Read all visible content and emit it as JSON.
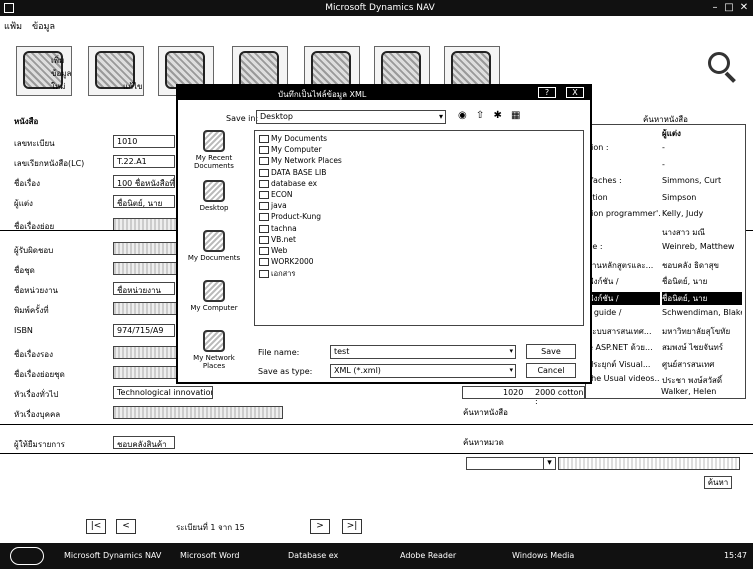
{
  "window": {
    "title": "Microsoft Dynamics NAV"
  },
  "menu": {
    "items": [
      "แฟ้ม",
      "ข้อมูล"
    ]
  },
  "toolbar": {
    "buttons": [
      {
        "label": "เพิ่ม\nข้อมูล\nใหม่"
      },
      {
        "label": "แก้ไข"
      },
      {
        "label": "ลบ"
      },
      {
        "label": ""
      },
      {
        "label": ""
      },
      {
        "label": ""
      },
      {
        "label": ""
      }
    ]
  },
  "form": {
    "section_title": "หนังสือ",
    "fields": [
      {
        "label": "เลขทะเบียน",
        "value": "1010",
        "gray": false
      },
      {
        "label": "เลขเรียกหนังสือ(LC)",
        "value": "T.22.A1",
        "gray": false
      },
      {
        "label": "ชื่อเรื่อง",
        "value": "100 ชื่อหนังสือที่",
        "gray": false
      },
      {
        "label": "ผู้แต่ง",
        "value": "ชื่อนิตย์, นาย",
        "gray": false
      },
      {
        "label": "ชื่อเรื่องย่อย",
        "value": "",
        "gray": true
      },
      {
        "label": "ผู้รับผิดชอบ",
        "value": "",
        "gray": true
      },
      {
        "label": "ชื่อชุด",
        "value": "",
        "gray": true
      },
      {
        "label": "ชื่อหน่วยงาน",
        "value": "ชื่อหน่วยงาน",
        "gray": false
      },
      {
        "label": "พิมพ์ครั้งที่",
        "value": "",
        "gray": true
      },
      {
        "label": "ISBN",
        "value": "974/715/A9",
        "gray": false
      },
      {
        "label": "ชื่อเรื่องรอง",
        "value": "",
        "gray": true
      },
      {
        "label": "ชื่อเรื่องย่อยชุด",
        "value": "",
        "gray": true
      },
      {
        "label": "หัวเรื่องทั่วไป",
        "value": "Technological innovations",
        "gray": false
      },
      {
        "label": "หัวเรื่องบุคคล",
        "value": "",
        "gray": true
      },
      {
        "label": "ผู้ให้ยืมรายการ",
        "value": "ชอบคลังสินค้า",
        "gray": false
      }
    ]
  },
  "table": {
    "search_label": "ค้นหาหนังสือ",
    "headers": [
      "",
      "ผู้แต่ง"
    ],
    "rows": [
      {
        "c1": "tion :",
        "c2": "-"
      },
      {
        "c1": "",
        "c2": "-"
      },
      {
        "c1": "ifaches :",
        "c2": "Simmons, Curt"
      },
      {
        "c1": "ction",
        "c2": "Simpson"
      },
      {
        "c1": "tion programmer'...",
        "c2": "Kelly, Judy"
      },
      {
        "c1": "",
        "c2": "นางสาว มณี"
      },
      {
        "c1": "ce :",
        "c2": "Weinreb, Matthew"
      },
      {
        "c1": "งานหลักสูตรและ...",
        "c2": "ชอบคลัง ธิดาสุข"
      },
      {
        "c1": "ฟังก์ชัน /",
        "c2": "ชื่อนิตย์, นาย"
      },
      {
        "c1": "ฟังก์ชัน /",
        "c2": "ชื่อนิตย์, นาย"
      },
      {
        "c1": "r guide /",
        "c2": "Schwendiman, Blake"
      },
      {
        "c1": "ระบบสารสนเทศ...",
        "c2": "มหาวิทยาลัยสุโขทัย"
      },
      {
        "c1": "e ASP.NET ด้วย...",
        "c2": "สมพงษ์ ไชยจันทร์"
      },
      {
        "c1": "ประยุกต์ Visual...",
        "c2": "ศูนย์สารสนเทศ"
      },
      {
        "c1": "the Usual videos...",
        "c2": "ประชา พงษ์สวัสดิ์"
      }
    ],
    "last_row": {
      "num": "1020",
      "text": "2000 cotton :",
      "author": "Walker, Helen"
    }
  },
  "below_table": {
    "author_label": "ค้นหาหนังสือ",
    "category_label": "ค้นหาหมวด",
    "search_button": "ค้นหา"
  },
  "navigator": {
    "first": "|<",
    "prev": "<",
    "label": "ระเบียนที่ 1 จาก 15",
    "next": ">",
    "last": ">|"
  },
  "dialog": {
    "title": "บันทึกเป็นไฟล์ข้อมูล XML",
    "help": "?",
    "close": "X",
    "save_in_label": "Save in:",
    "save_in_value": "Desktop",
    "toolbar_icons": "◉ ⇧ ✱ ▦",
    "places": [
      "My Recent Documents",
      "Desktop",
      "My Documents",
      "My Computer",
      "My Network Places"
    ],
    "files": [
      "My Documents",
      "My Computer",
      "My Network Places",
      "DATA BASE LIB",
      "database ex",
      "ECON",
      "java",
      "Product-Kung",
      "tachna",
      "VB.net",
      "Web",
      "WORK2000",
      "เอกสาร"
    ],
    "filename_label": "File name:",
    "filename_value": "test",
    "savetype_label": "Save as type:",
    "savetype_value": "XML (*.xml)",
    "save_button": "Save",
    "cancel_button": "Cancel"
  },
  "taskbar": {
    "items": [
      "Microsoft Dynamics NAV",
      "Microsoft Word",
      "Database ex",
      "Adobe Reader",
      "Windows Media"
    ],
    "tray": "15:47"
  }
}
